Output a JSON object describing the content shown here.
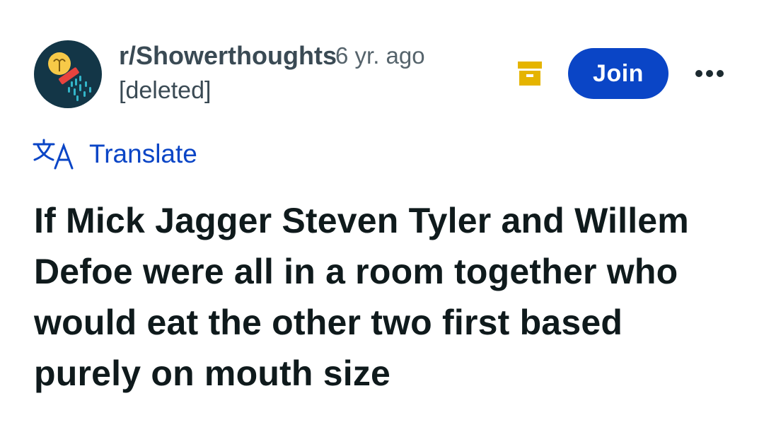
{
  "post": {
    "subreddit": "r/Showerthoughts",
    "age": "6 yr. ago",
    "author": "[deleted]",
    "join_label": "Join",
    "translate_label": "Translate",
    "title": "If Mick Jagger Steven Tyler and Willem Defoe were all in a room together who would eat the other two first based purely on mouth size"
  },
  "icons": {
    "avatar": "showerthoughts-logo-icon",
    "archive": "archive-icon",
    "more": "more-options-icon",
    "translate": "translate-icon"
  },
  "colors": {
    "accent": "#0a45c6",
    "archive": "#e5b400",
    "avatar_bg": "#133647",
    "title_text": "#0f1a1c"
  }
}
